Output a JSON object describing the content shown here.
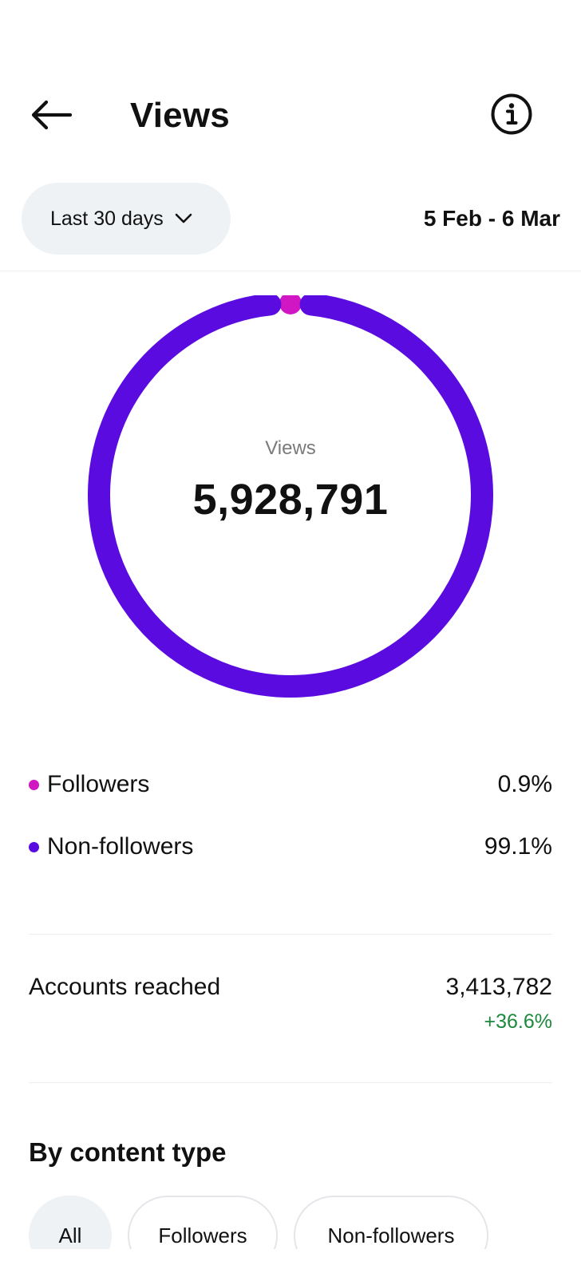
{
  "header": {
    "title": "Views"
  },
  "filter": {
    "range_label": "Last 30 days",
    "date_range": "5 Feb - 6 Mar"
  },
  "chart_data": {
    "type": "pie",
    "center_label": "Views",
    "center_value": "5,928,791",
    "categories": [
      "Followers",
      "Non-followers"
    ],
    "values": [
      0.9,
      99.1
    ],
    "colors": [
      "#d116c3",
      "#5a0be0"
    ]
  },
  "breakdown": {
    "items": [
      {
        "label": "Followers",
        "value": "0.9%",
        "color": "#d116c3"
      },
      {
        "label": "Non-followers",
        "value": "99.1%",
        "color": "#5a0be0"
      }
    ]
  },
  "reach": {
    "label": "Accounts reached",
    "value": "3,413,782",
    "change": "+36.6%",
    "change_color": "#1c8a3c"
  },
  "content_type": {
    "title": "By content type",
    "chips": [
      {
        "label": "All",
        "active": true
      },
      {
        "label": "Followers",
        "active": false
      },
      {
        "label": "Non-followers",
        "active": false
      }
    ]
  },
  "icons": {
    "back": "arrow-left-icon",
    "info": "info-icon",
    "dropdown": "chevron-down-icon"
  }
}
